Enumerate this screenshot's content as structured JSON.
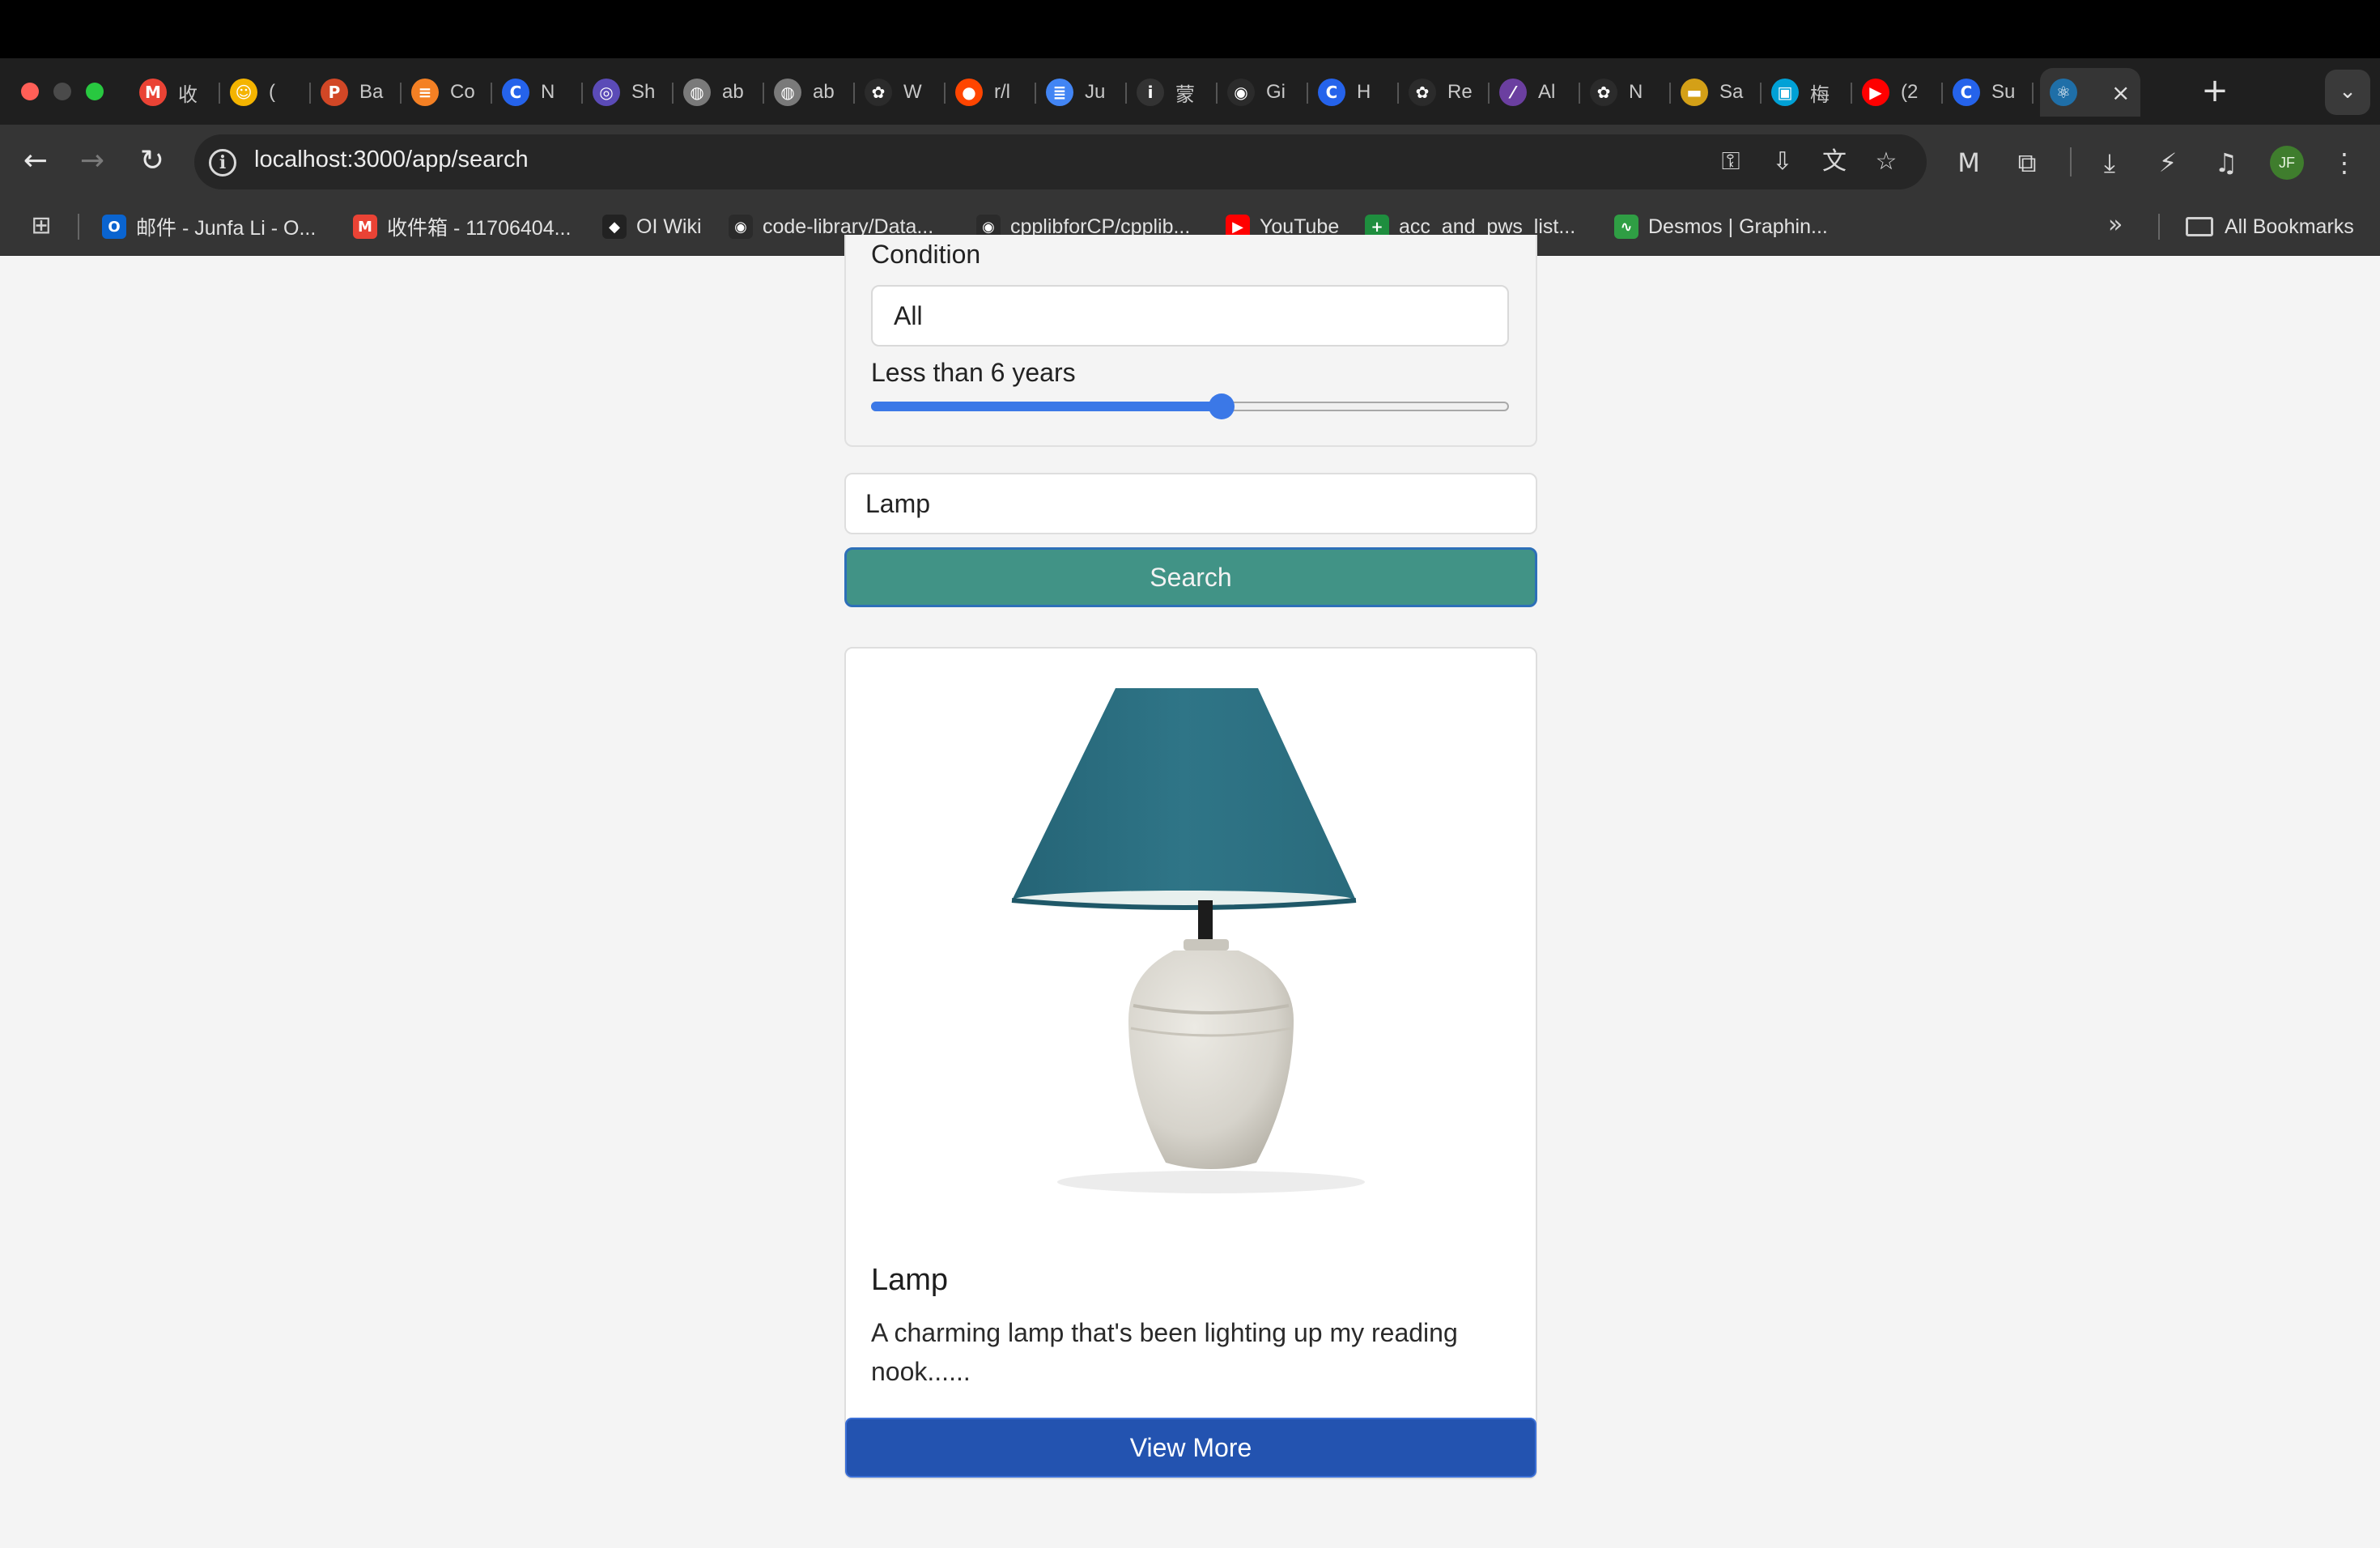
{
  "browser": {
    "tabs": [
      {
        "title": "收",
        "icon": "gmail-icon",
        "color": "#ea4335",
        "glyph": "M"
      },
      {
        "title": "(",
        "icon": "sunglasses-icon",
        "color": "#f4b400",
        "glyph": "☺"
      },
      {
        "title": "Ba",
        "icon": "powerpoint-icon",
        "color": "#d24726",
        "glyph": "P"
      },
      {
        "title": "Co",
        "icon": "stack-icon",
        "color": "#f48024",
        "glyph": "≡"
      },
      {
        "title": "N",
        "icon": "c-icon",
        "color": "#2563eb",
        "glyph": "C"
      },
      {
        "title": "Sh",
        "icon": "spiral-icon",
        "color": "#5b4bb7",
        "glyph": "◎"
      },
      {
        "title": "ab",
        "icon": "globe-icon",
        "color": "#7a7a7a",
        "glyph": "◍"
      },
      {
        "title": "ab",
        "icon": "globe-icon",
        "color": "#7a7a7a",
        "glyph": "◍"
      },
      {
        "title": "W",
        "icon": "openai-icon",
        "color": "#2b2b2b",
        "glyph": "✿"
      },
      {
        "title": "r/l",
        "icon": "reddit-icon",
        "color": "#ff4500",
        "glyph": "●"
      },
      {
        "title": "Ju",
        "icon": "docs-icon",
        "color": "#4285f4",
        "glyph": "≣"
      },
      {
        "title": "蒙",
        "icon": "info-icon",
        "color": "#333333",
        "glyph": "i"
      },
      {
        "title": "Gi",
        "icon": "github-icon",
        "color": "#2b2b2b",
        "glyph": "◉"
      },
      {
        "title": "H",
        "icon": "c-icon",
        "color": "#2563eb",
        "glyph": "C"
      },
      {
        "title": "Re",
        "icon": "openai-icon",
        "color": "#2b2b2b",
        "glyph": "✿"
      },
      {
        "title": "Al",
        "icon": "slash-icon",
        "color": "#6b3fa0",
        "glyph": "⁄"
      },
      {
        "title": "N",
        "icon": "openai-icon",
        "color": "#2b2b2b",
        "glyph": "✿"
      },
      {
        "title": "Sa",
        "icon": "flag-icon",
        "color": "#d4a017",
        "glyph": "▬"
      },
      {
        "title": "梅",
        "icon": "bilibili-icon",
        "color": "#00a1d6",
        "glyph": "▣"
      },
      {
        "title": "(2",
        "icon": "youtube-icon",
        "color": "#ff0000",
        "glyph": "▶"
      },
      {
        "title": "Su",
        "icon": "c-icon",
        "color": "#2563eb",
        "glyph": "C"
      },
      {
        "title": "",
        "icon": "react-icon",
        "color": "#1f6fa8",
        "glyph": "⚛",
        "active": true
      }
    ],
    "url": "localhost:3000/app/search",
    "profile_initials": "JF",
    "bookmarks": [
      {
        "label": "邮件 - Junfa Li - O...",
        "icon": "outlook-icon",
        "color": "#0a64d0",
        "glyph": "O"
      },
      {
        "label": "收件箱 - 11706404...",
        "icon": "gmail-icon",
        "color": "#ea4335",
        "glyph": "M"
      },
      {
        "label": "OI Wiki",
        "icon": "graduation-cap-icon",
        "color": "#222222",
        "glyph": "◆"
      },
      {
        "label": "code-library/Data...",
        "icon": "github-icon",
        "color": "#2b2b2b",
        "glyph": "◉"
      },
      {
        "label": "cpplibforCP/cpplib...",
        "icon": "github-icon",
        "color": "#2b2b2b",
        "glyph": "◉"
      },
      {
        "label": "YouTube",
        "icon": "youtube-icon",
        "color": "#ff0000",
        "glyph": "▶"
      },
      {
        "label": "acc_and_pws_list...",
        "icon": "sheets-plus-icon",
        "color": "#1e8e3e",
        "glyph": "+"
      },
      {
        "label": "Desmos | Graphin...",
        "icon": "desmos-icon",
        "color": "#2f9e44",
        "glyph": "∿"
      }
    ],
    "all_bookmarks_label": "All Bookmarks"
  },
  "filters": {
    "condition_label": "Condition",
    "condition_value": "All",
    "age_label": "Less than 6 years",
    "age_slider_fraction": 0.55
  },
  "search": {
    "query": "Lamp",
    "button_label": "Search"
  },
  "result": {
    "title": "Lamp",
    "description": "A charming lamp that's been lighting up my reading nook......",
    "button_label": "View More"
  },
  "colors": {
    "search_button": "#419386",
    "view_more_button": "#2353b0",
    "slider": "#3b78e7",
    "lamp_shade": "#2f7587"
  }
}
